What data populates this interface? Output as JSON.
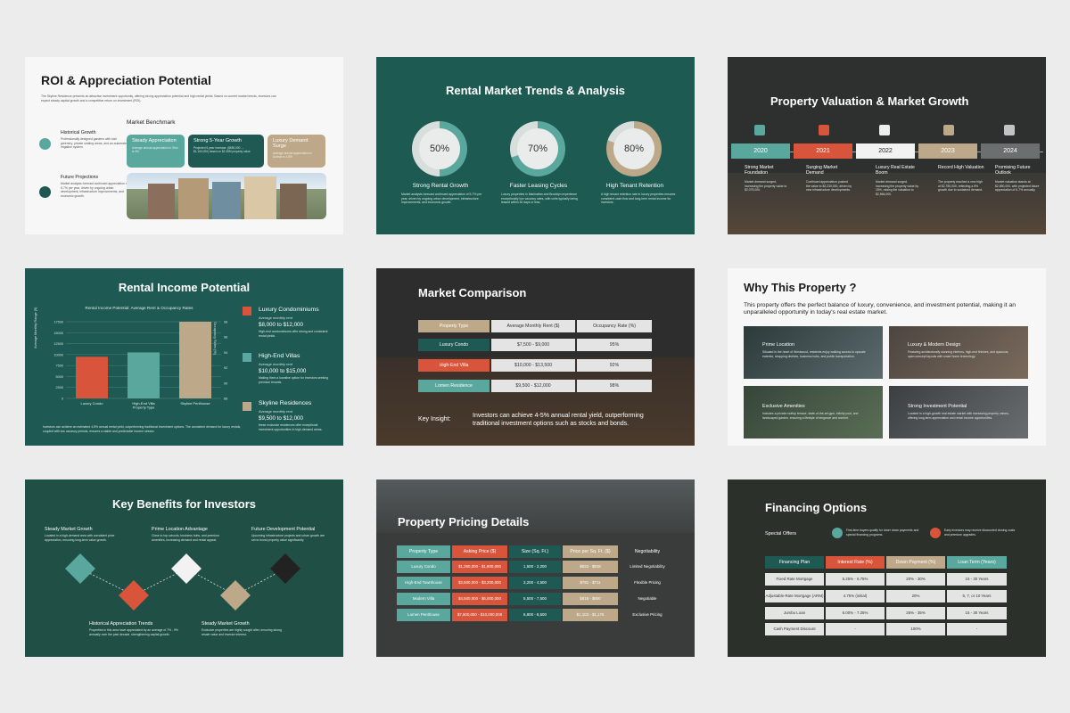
{
  "colors": {
    "teal": "#5aa79e",
    "dark_teal": "#1e5a53",
    "coral": "#d8553b",
    "tan": "#bda889",
    "grey": "#e4e4e4"
  },
  "s1": {
    "title": "ROI & Appreciation Potential",
    "intro": "The Skyline Residence presents an attractive investment opportunity, offering strong appreciation potential and high rental yields. Based on current market trends, investors can expect steady capital growth and a competitive return on investment (ROI).",
    "historical": {
      "heading": "Historical Growth",
      "text": "Professionally designed gardens with lush greenery, private seating areas, and an automated irrigation system."
    },
    "projections": {
      "heading": "Future Projections",
      "text": "Market analysts forecast continued appreciation of 5-7% per year, driven by ongoing urban development, infrastructure improvements, and economic growth."
    },
    "benchmark_title": "Market Benchmark",
    "benchmarks": [
      {
        "label": "Steady Appreciation",
        "sub": "Average annual appreciation in Ohio is 4%"
      },
      {
        "label": "Strong 5-Year Growth",
        "sub": "Projected 5-year increase: ($650,000 → $1,160,000) based on $2.35M property value"
      },
      {
        "label": "Luxury Demand Surge",
        "sub": "Average annual appreciation in Durban is 4.8%"
      }
    ]
  },
  "s2": {
    "title": "Rental Market Trends & Analysis",
    "items": [
      {
        "pct": "50%",
        "value": 50,
        "label": "Strong Rental Growth",
        "text": "Market analysts forecast continued appreciation of 5-7% per year, driven by ongoing urban development, infrastructure improvements, and economic growth."
      },
      {
        "pct": "70%",
        "value": 70,
        "label": "Faster Leasing Cycles",
        "text": "Luxury properties in Manhattan and Brooklyn experience exceptionally low vacancy rates, with units typically being leased within 30 days or less."
      },
      {
        "pct": "80%",
        "value": 80,
        "label": "High Tenant Retention",
        "text": "A high tenant retention rate in luxury properties ensures consistent cash flow and long-term rental income for investors."
      }
    ]
  },
  "s3": {
    "title": "Property Valuation & Market Growth",
    "years": [
      {
        "year": "2020",
        "label": "Strong Market Foundation",
        "text": "Market demand surged, increasing the property value to $2,075,000."
      },
      {
        "year": "2021",
        "label": "Surging Market Demand",
        "text": "Continued appreciation pushed the value to $2,230,000, driven by new infrastructure developments."
      },
      {
        "year": "2022",
        "label": "Luxury Real Estate Boom",
        "text": "Market demand surged, increasing the property value by 15%, raising the valuation to $2,565,000."
      },
      {
        "year": "2023",
        "label": "Record High Valuation",
        "text": "The property reached a new high of $2,780,000, reflecting a 5% growth due to sustained demand."
      },
      {
        "year": "2024",
        "label": "Promising Future Outlook",
        "text": "Market valuation stands at $2,850,000, with projected future appreciation of 6-7% annually."
      }
    ]
  },
  "s4": {
    "title": "Rental Income Potential",
    "footer": "Investors can achieve an estimated 4-5% annual rental yield, outperforming traditional investment options. The consistent demand for luxury rentals, coupled with low vacancy periods, ensures a stable and predictable income stream.",
    "units": [
      {
        "name": "Luxury Condominiums",
        "sub": "Average monthly rent",
        "range": "$8,000 to $12,000",
        "text": "High-end condominiums offer strong and consistent rental yields."
      },
      {
        "name": "High-End Villas",
        "sub": "Average monthly rent",
        "range": "$10,000 to $15,000",
        "text": "Making them a lucrative option for investors seeking premium tenants."
      },
      {
        "name": "Skyline Residences",
        "sub": "Average monthly rent",
        "range": "$9,500 to $12,000",
        "text": "these exclusive residences offer exceptional investment opportunities in high-demand areas."
      }
    ]
  },
  "chart_data": {
    "type": "bar",
    "title": "Rental Income Potential: Average Rent & Occupancy Rates",
    "categories": [
      "Luxury Condo",
      "High-End Villa Property Type",
      "Skyline Penthouse"
    ],
    "values": [
      9500,
      10500,
      17500
    ],
    "ylabel": "Average Monthly Range ($)",
    "y2label": "Occupancy Rates (%)",
    "ylim": [
      0,
      17500
    ],
    "yticks": [
      "17500",
      "15000",
      "12500",
      "10000",
      "7500",
      "5000",
      "2500",
      "0"
    ],
    "y2ticks": [
      "98",
      "96",
      "94",
      "92",
      "90",
      "88"
    ],
    "colors": [
      "#d8553b",
      "#5aa79e",
      "#bda889"
    ]
  },
  "s5": {
    "title": "Market Comparison",
    "headers": [
      "Property Type",
      "Average Monthly Rent ($)",
      "Occupancy Rate (%)"
    ],
    "rows": [
      [
        "Luxury Condo",
        "$7,500 - $9,000",
        "95%"
      ],
      [
        "High-End Villa",
        "$10,000 - $13,500",
        "92%"
      ],
      [
        "Lomen Residence",
        "$9,500 - $12,000",
        "98%"
      ]
    ],
    "insight_label": "Key Insight:",
    "insight": "Investors can achieve 4-5% annual rental yield, outperforming traditional investment options such as stocks and bonds."
  },
  "s6": {
    "title": "Why This Property ?",
    "intro": "This property offers the perfect balance of luxury, convenience, and investment potential, making it an unparalleled opportunity in today's real estate market.",
    "cards": [
      {
        "label": "Prime Location",
        "text": "Situated in the heart of Westwood, residents enjoy walking access to upscale eateries, shopping districts, business hubs, and public transportation."
      },
      {
        "label": "Luxury & Modern Design",
        "text": "Featuring architecturally stunning interiors, high-end finishes, and spacious, open-concept layouts with smart home technology."
      },
      {
        "label": "Exclusive Amenities",
        "text": "Includes a private rooftop terrace, state-of-the-art gym, infinity pool, and landscaped garden, ensuring a lifestyle of elegance and comfort."
      },
      {
        "label": "Strong Investment Potential",
        "text": "Located in a high-growth real estate market with increasing property values, offering long-term appreciation and rental income opportunities."
      }
    ]
  },
  "s7": {
    "title": "Key Benefits for Investors",
    "top": [
      {
        "label": "Steady Market Growth",
        "text": "Located in a high-demand area with consistent price appreciation, ensuring long-term value growth."
      },
      {
        "label": "Prime Location Advantage",
        "text": "Close to top schools, business hubs, and premium amenities, increasing demand and rental appeal."
      },
      {
        "label": "Future Development Potential",
        "text": "Upcoming infrastructure projects and urban growth are set to boost property value significantly."
      }
    ],
    "bottom": [
      {
        "label": "Historical Appreciation Trends",
        "text": "Properties in this area have appreciated by an average of 7% - 9% annually over the past decade, strengthening capital growth."
      },
      {
        "label": "Steady Market Growth",
        "text": "Exclusive properties are highly sought after, ensuring strong resale value and investor interest."
      }
    ]
  },
  "s8": {
    "title": "Property Pricing Details",
    "headers": [
      "Property Type",
      "Asking Price ($)",
      "Size (Sq. Ft.)",
      "Price per Sq. Ft. ($)",
      "Negotiability"
    ],
    "rows": [
      [
        "Luxury Condo",
        "$1,250,000 - $1,800,000",
        "1,500 - 2,200",
        "$833 - $818",
        "Limited Negotiability"
      ],
      [
        "High-End Townhouse",
        "$2,500,000 - $3,200,000",
        "3,200 - 4,500",
        "$781 - $711",
        "Flexible Pricing"
      ],
      [
        "Modern Villa",
        "$4,500,000 - $6,000,000",
        "5,500 - 7,500",
        "$818 - $800",
        "Negotiable"
      ],
      [
        "Lomen Penthouse",
        "$7,500,000 - $10,000,000",
        "6,800 - 8,500",
        "$1,103 - $1,176",
        "Exclusive Pricing"
      ]
    ]
  },
  "s9": {
    "title": "Financing Options",
    "offers_label": "Special Offers",
    "offer1": "First-time buyers qualify for lower down payments and special financing programs.",
    "offer2": "Early investors may receive discounted closing costs and premium upgrades.",
    "headers": [
      "Financing Plan",
      "Interest Rate (%)",
      "Down Payment (%)",
      "Loan Term (Years)"
    ],
    "rows": [
      [
        "Fixed Rate Mortgage",
        "5.25% - 6.75%",
        "20% - 30%",
        "15 - 30 Years"
      ],
      [
        "Adjustable-Rate Mortgage (ARM)",
        "4.75% (initial)",
        "20%",
        "5, 7, or 10 Years"
      ],
      [
        "Jumbo Loan",
        "6.00% - 7.25%",
        "25% - 35%",
        "15 - 30 Years"
      ],
      [
        "Cash Payment Discount",
        "-",
        "100%",
        "-"
      ]
    ]
  }
}
